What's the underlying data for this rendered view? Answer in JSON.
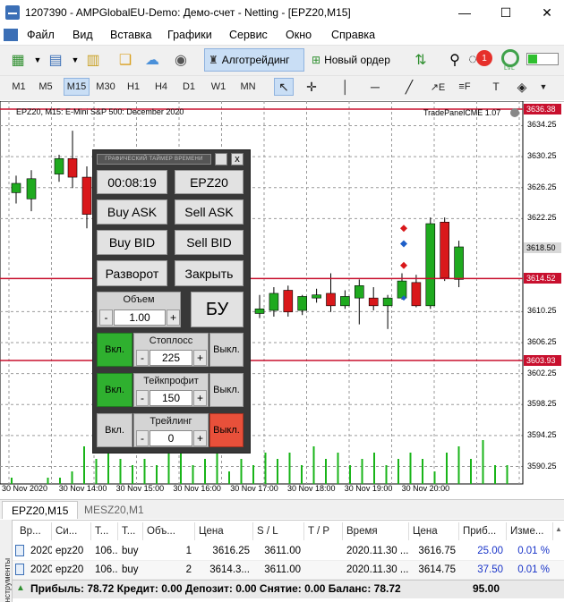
{
  "window": {
    "title": "1207390 - AMPGlobalEU-Demo: Демо-счет - Netting - [EPZ20,M15]",
    "minimize": "—",
    "maximize": "☐",
    "close": "✕"
  },
  "menu": [
    "Файл",
    "Вид",
    "Вставка",
    "Графики",
    "Сервис",
    "Окно",
    "Справка"
  ],
  "toolbar": {
    "algo_label": "Алготрейдинг",
    "new_order_label": "Новый ордер",
    "notifications_count": "1",
    "lvl_label": "LVL"
  },
  "timeframes": [
    "M1",
    "M5",
    "M15",
    "M30",
    "H1",
    "H4",
    "D1",
    "W1",
    "MN"
  ],
  "active_timeframe": "M15",
  "chart": {
    "header": "EPZ20, M15:  E-Mini S&P 500: December 2020",
    "indicator": "TradePanelCME 1.07",
    "price_ticks": [
      "3634.25",
      "3630.25",
      "3626.25",
      "3622.25",
      "3610.25",
      "3606.25",
      "3602.25",
      "3598.25",
      "3594.25",
      "3590.25"
    ],
    "price_tags": {
      "top": "3636.38",
      "current": "3618.50",
      "line_red": "3614.52",
      "line_low": "3603.93"
    },
    "time_labels": [
      "30 Nov 2020",
      "30 Nov 14:00",
      "30 Nov 15:00",
      "30 Nov 16:00",
      "30 Nov 17:00",
      "30 Nov 18:00",
      "30 Nov 19:00",
      "30 Nov 20:00"
    ],
    "colors": {
      "bull": "#1faa1f",
      "bear": "#d9181b",
      "level_line": "#c8102e",
      "volume": "#19b419"
    }
  },
  "chart_data": {
    "type": "candlestick",
    "symbol": "EPZ20",
    "timeframe": "M15",
    "ylim": [
      3588.0,
      3636.5
    ],
    "candles": [
      {
        "o": 3625.6,
        "h": 3627.8,
        "l": 3624.2,
        "c": 3626.8
      },
      {
        "o": 3624.8,
        "h": 3628.5,
        "l": 3623.2,
        "c": 3627.4
      },
      {
        "o": 3628.0,
        "h": 3630.5,
        "l": 3627.0,
        "c": 3630.0
      },
      {
        "o": 3630.0,
        "h": 3633.6,
        "l": 3626.2,
        "c": 3627.6
      },
      {
        "o": 3627.6,
        "h": 3629.0,
        "l": 3621.0,
        "c": 3622.8
      },
      {
        "o": 3610.0,
        "h": 3612.4,
        "l": 3609.4,
        "c": 3610.6
      },
      {
        "o": 3610.4,
        "h": 3613.4,
        "l": 3609.6,
        "c": 3612.6
      },
      {
        "o": 3613.0,
        "h": 3613.6,
        "l": 3609.6,
        "c": 3610.2
      },
      {
        "o": 3610.4,
        "h": 3612.4,
        "l": 3609.8,
        "c": 3612.2
      },
      {
        "o": 3612.0,
        "h": 3613.2,
        "l": 3611.4,
        "c": 3612.4
      },
      {
        "o": 3612.6,
        "h": 3615.2,
        "l": 3610.2,
        "c": 3611.0
      },
      {
        "o": 3611.0,
        "h": 3613.0,
        "l": 3610.6,
        "c": 3612.2
      },
      {
        "o": 3612.0,
        "h": 3614.4,
        "l": 3608.6,
        "c": 3613.6
      },
      {
        "o": 3612.0,
        "h": 3613.4,
        "l": 3610.4,
        "c": 3611.0
      },
      {
        "o": 3611.0,
        "h": 3612.4,
        "l": 3608.0,
        "c": 3612.0
      },
      {
        "o": 3612.0,
        "h": 3615.2,
        "l": 3611.8,
        "c": 3614.2
      },
      {
        "o": 3614.0,
        "h": 3615.0,
        "l": 3610.8,
        "c": 3611.0
      },
      {
        "o": 3611.0,
        "h": 3622.4,
        "l": 3610.6,
        "c": 3621.6
      },
      {
        "o": 3621.8,
        "h": 3622.4,
        "l": 3614.2,
        "c": 3614.6
      },
      {
        "o": 3614.4,
        "h": 3619.4,
        "l": 3613.4,
        "c": 3618.6
      }
    ],
    "volumes": [
      1,
      0,
      0,
      1,
      1,
      2,
      6,
      4,
      7,
      4,
      3,
      4,
      3,
      6,
      5,
      3,
      4,
      6,
      2,
      4,
      3,
      5,
      4,
      5,
      3,
      6,
      4,
      5,
      3,
      4,
      5,
      3,
      4,
      5,
      4,
      2,
      5,
      6,
      4,
      7,
      3,
      3
    ]
  },
  "panel": {
    "title": "ГРАФИЧЕСКИЙ ТАЙМЕР ВРЕМЕНИ",
    "close": "x",
    "timer": "00:08:19",
    "symbol": "EPZ20",
    "buy_ask": "Buy ASK",
    "sell_ask": "Sell ASK",
    "buy_bid": "Buy BID",
    "sell_bid": "Sell BID",
    "reverse": "Разворот",
    "close_pos": "Закрыть",
    "volume_label": "Объем",
    "volume_value": "1.00",
    "minus": "-",
    "plus": "+",
    "breakeven": "БУ",
    "stoploss_label": "Стоплосс",
    "stoploss_value": "225",
    "takeprofit_label": "Тейкпрофит",
    "takeprofit_value": "150",
    "trailing_label": "Трейлинг",
    "trailing_value": "0",
    "on": "Вкл.",
    "off": "Выкл."
  },
  "tabs": {
    "active": "EPZ20,M15",
    "inactive": "MESZ20,M1"
  },
  "terminal": {
    "side_label": "Инструменты",
    "columns": [
      "Вр...",
      "Си...",
      "Т...",
      "Т...",
      "Объ...",
      "Цена",
      "S / L",
      "T / P",
      "Время",
      "Цена",
      "Приб...",
      "Изме..."
    ],
    "rows": [
      [
        "2020....",
        "epz20",
        "106...",
        "buy",
        "1",
        "3616.25",
        "3611.00",
        "",
        "2020.11.30 ...",
        "3616.75",
        "25.00",
        "0.01 %"
      ],
      [
        "2020....",
        "epz20",
        "106...",
        "buy",
        "2",
        "3614.3...",
        "3611.00",
        "",
        "2020.11.30 ...",
        "3614.75",
        "37.50",
        "0.01 %"
      ]
    ],
    "totals": "Прибыль: 78.72  Кредит: 0.00  Депозит: 0.00  Снятие: 0.00  Баланс: 78.72",
    "totals_value": "95.00"
  }
}
